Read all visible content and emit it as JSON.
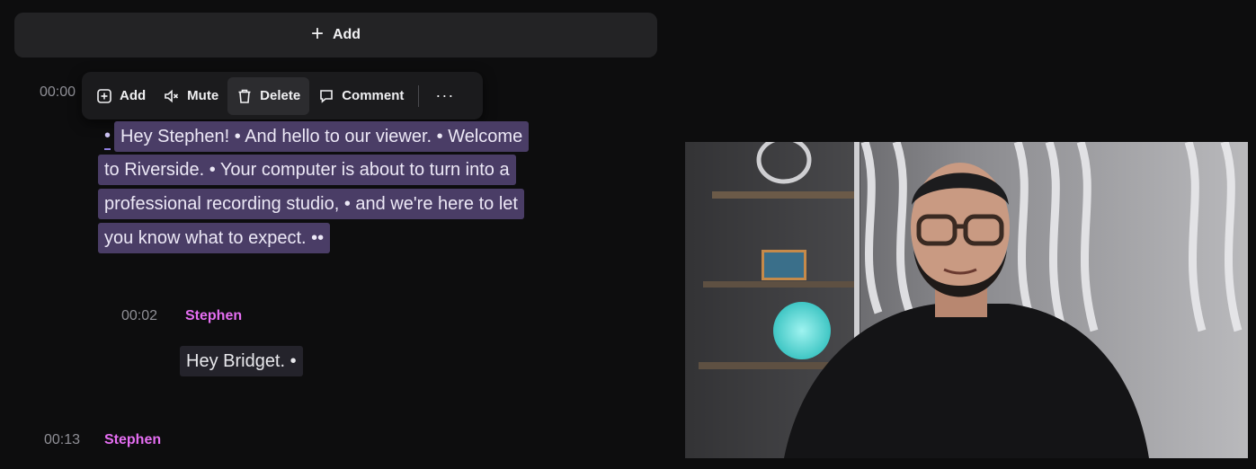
{
  "add_bar": {
    "label": "Add"
  },
  "toolbar": {
    "add": "Add",
    "mute": "Mute",
    "delete": "Delete",
    "comment": "Comment",
    "more": "···"
  },
  "segments": [
    {
      "timestamp": "00:00",
      "lead_marker": "•",
      "lines": [
        "Hey Stephen! • And hello to our viewer. • Welcome",
        "to Riverside. • Your computer is about to turn into a",
        "professional recording studio, • and we're here to let",
        "you know what to expect. ••"
      ]
    },
    {
      "timestamp": "00:02",
      "speaker": "Stephen",
      "text": "Hey Bridget. •"
    },
    {
      "timestamp": "00:13",
      "speaker": "Stephen"
    }
  ],
  "colors": {
    "speaker": "#e56ef2",
    "selection": "#4a3d66",
    "background": "#0d0d0e"
  }
}
